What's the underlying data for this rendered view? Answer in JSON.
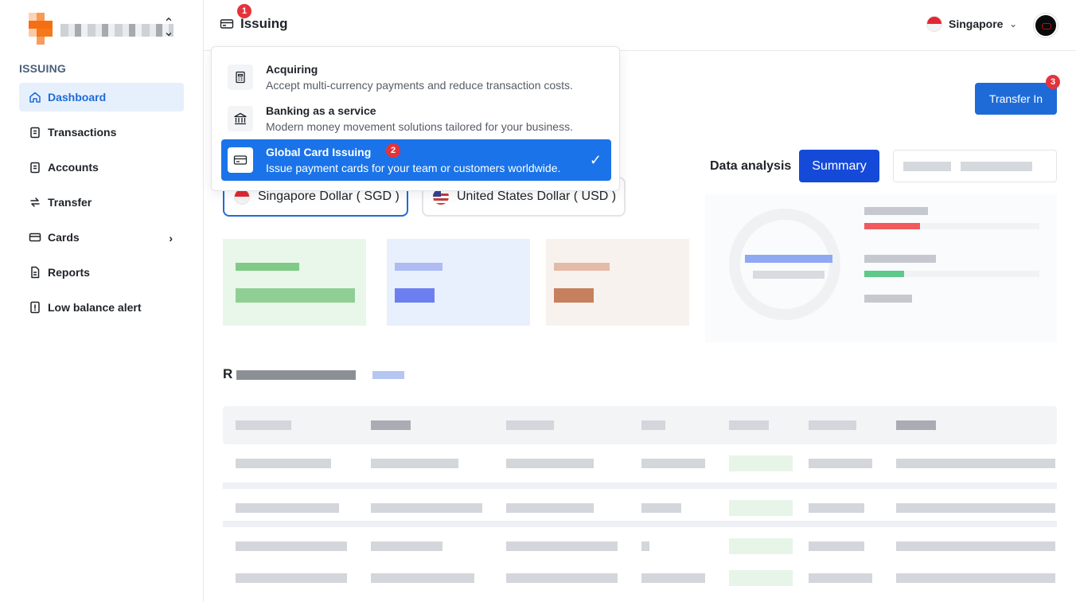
{
  "sidebar": {
    "section_label": "ISSUING",
    "items": [
      {
        "label": "Dashboard",
        "icon": "home-icon"
      },
      {
        "label": "Transactions",
        "icon": "clipboard-icon"
      },
      {
        "label": "Accounts",
        "icon": "clipboard-icon"
      },
      {
        "label": "Transfer",
        "icon": "transfer-icon"
      },
      {
        "label": "Cards",
        "icon": "card-icon"
      },
      {
        "label": "Reports",
        "icon": "document-icon"
      },
      {
        "label": "Low balance alert",
        "icon": "alert-icon"
      }
    ]
  },
  "topbar": {
    "product_label": "Issuing",
    "region_label": "Singapore"
  },
  "badges": {
    "one": "1",
    "two": "2",
    "three": "3"
  },
  "dropdown": {
    "items": [
      {
        "title": "Acquiring",
        "description": "Accept multi-currency payments and reduce transaction costs."
      },
      {
        "title": "Banking as a service",
        "description": "Modern money movement solutions tailored for your business."
      },
      {
        "title": "Global Card Issuing",
        "description": "Issue payment cards for your team or customers worldwide."
      }
    ]
  },
  "main": {
    "transfer_in": "Transfer In",
    "data_analysis": "Data analysis",
    "summary": "Summary",
    "currencies": [
      "Singapore Dollar ( SGD )",
      "United States Dollar ( USD )"
    ],
    "recent_title_prefix": "R"
  },
  "colors": {
    "accent": "#1e6bd8",
    "selected": "#1a73e8",
    "badge": "#e5333b"
  }
}
